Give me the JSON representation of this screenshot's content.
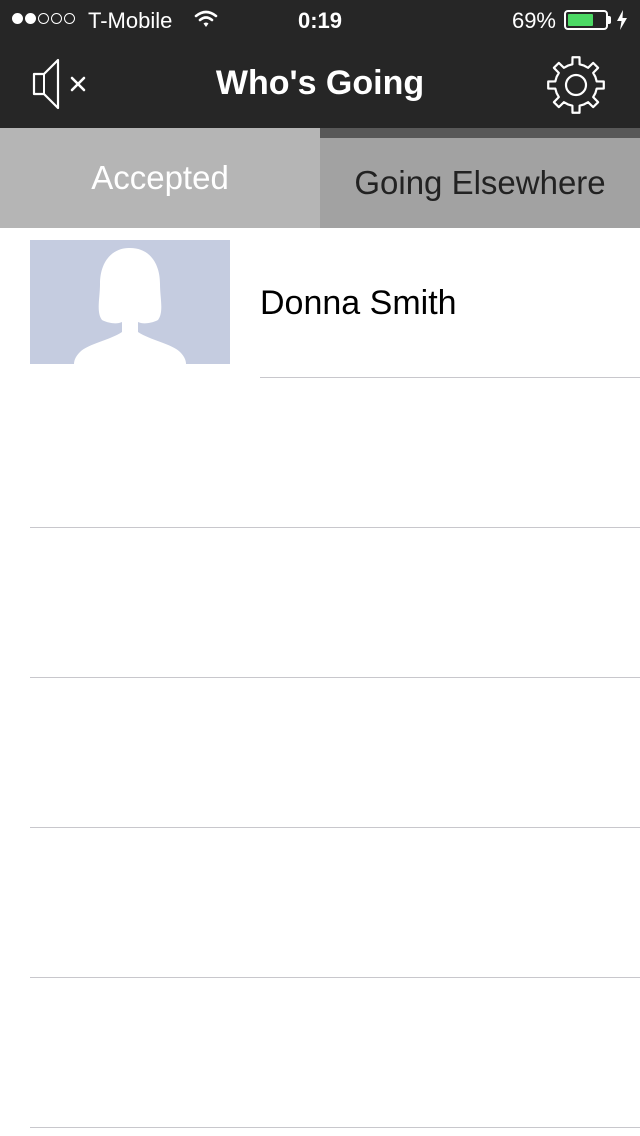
{
  "status_bar": {
    "carrier": "T-Mobile",
    "signal_bars_filled": 2,
    "signal_bars_total": 5,
    "time": "0:19",
    "battery_percent": "69%",
    "battery_level": 0.69,
    "battery_color": "#4cd964"
  },
  "nav": {
    "title": "Who's Going",
    "left_icon": "speaker-muted-icon",
    "right_icon": "gear-icon"
  },
  "tabs": [
    {
      "label": "Accepted",
      "selected": true
    },
    {
      "label": "Going Elsewhere",
      "selected": false
    }
  ],
  "list": {
    "items": [
      {
        "name": "Donna Smith",
        "avatar": "default-female-avatar"
      }
    ]
  }
}
